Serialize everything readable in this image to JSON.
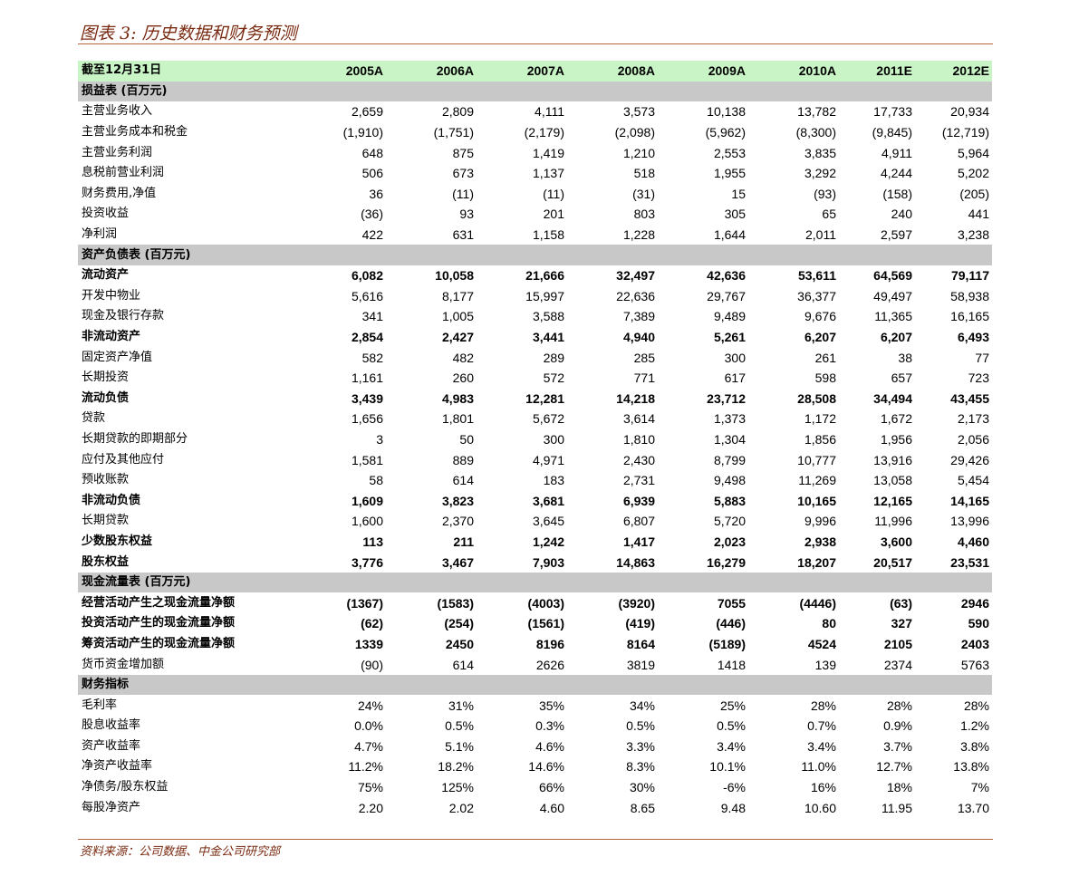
{
  "title": "图表 3: 历史数据和财务预测",
  "source": "资料来源：公司数据、中金公司研究部",
  "colors": {
    "header_bg": "#c9f5c6",
    "section_bg": "#c8c8c8",
    "title": "#7a2a10",
    "rule": "#b5643c"
  },
  "header": {
    "label": "截至12月31日",
    "years": [
      "2005A",
      "2006A",
      "2007A",
      "2008A",
      "2009A",
      "2010A",
      "2011E",
      "2012E"
    ]
  },
  "rows": [
    {
      "type": "section",
      "label": "损益表 (百万元)"
    },
    {
      "type": "row",
      "label": "主营业务收入",
      "values": [
        "2,659",
        "2,809",
        "4,111",
        "3,573",
        "10,138",
        "13,782",
        "17,733",
        "20,934"
      ]
    },
    {
      "type": "row",
      "label": "主营业务成本和税金",
      "values": [
        "(1,910)",
        "(1,751)",
        "(2,179)",
        "(2,098)",
        "(5,962)",
        "(8,300)",
        "(9,845)",
        "(12,719)"
      ]
    },
    {
      "type": "row",
      "label": "主营业务利润",
      "values": [
        "648",
        "875",
        "1,419",
        "1,210",
        "2,553",
        "3,835",
        "4,911",
        "5,964"
      ]
    },
    {
      "type": "row",
      "label": "息税前营业利润",
      "values": [
        "506",
        "673",
        "1,137",
        "518",
        "1,955",
        "3,292",
        "4,244",
        "5,202"
      ]
    },
    {
      "type": "row",
      "label": "财务费用,净值",
      "values": [
        "36",
        "(11)",
        "(11)",
        "(31)",
        "15",
        "(93)",
        "(158)",
        "(205)"
      ]
    },
    {
      "type": "row",
      "label": "投资收益",
      "values": [
        "(36)",
        "93",
        "201",
        "803",
        "305",
        "65",
        "240",
        "441"
      ]
    },
    {
      "type": "row",
      "label": "净利润",
      "values": [
        "422",
        "631",
        "1,158",
        "1,228",
        "1,644",
        "2,011",
        "2,597",
        "3,238"
      ]
    },
    {
      "type": "section",
      "label": "资产负债表 (百万元)"
    },
    {
      "type": "bold",
      "label": "流动资产",
      "values": [
        "6,082",
        "10,058",
        "21,666",
        "32,497",
        "42,636",
        "53,611",
        "64,569",
        "79,117"
      ]
    },
    {
      "type": "row",
      "label": "开发中物业",
      "values": [
        "5,616",
        "8,177",
        "15,997",
        "22,636",
        "29,767",
        "36,377",
        "49,497",
        "58,938"
      ]
    },
    {
      "type": "row",
      "label": "现金及银行存款",
      "values": [
        "341",
        "1,005",
        "3,588",
        "7,389",
        "9,489",
        "9,676",
        "11,365",
        "16,165"
      ]
    },
    {
      "type": "bold",
      "label": "非流动资产",
      "values": [
        "2,854",
        "2,427",
        "3,441",
        "4,940",
        "5,261",
        "6,207",
        "6,207",
        "6,493"
      ]
    },
    {
      "type": "row",
      "label": "固定资产净值",
      "values": [
        "582",
        "482",
        "289",
        "285",
        "300",
        "261",
        "38",
        "77"
      ]
    },
    {
      "type": "row",
      "label": "长期投资",
      "values": [
        "1,161",
        "260",
        "572",
        "771",
        "617",
        "598",
        "657",
        "723"
      ]
    },
    {
      "type": "bold",
      "label": "流动负债",
      "values": [
        "3,439",
        "4,983",
        "12,281",
        "14,218",
        "23,712",
        "28,508",
        "34,494",
        "43,455"
      ]
    },
    {
      "type": "row",
      "label": "贷款",
      "values": [
        "1,656",
        "1,801",
        "5,672",
        "3,614",
        "1,373",
        "1,172",
        "1,672",
        "2,173"
      ]
    },
    {
      "type": "row",
      "label": "长期贷款的即期部分",
      "values": [
        "3",
        "50",
        "300",
        "1,810",
        "1,304",
        "1,856",
        "1,956",
        "2,056"
      ]
    },
    {
      "type": "row",
      "label": "应付及其他应付",
      "values": [
        "1,581",
        "889",
        "4,971",
        "2,430",
        "8,799",
        "10,777",
        "13,916",
        "29,426"
      ]
    },
    {
      "type": "row",
      "label": "预收账款",
      "values": [
        "58",
        "614",
        "183",
        "2,731",
        "9,498",
        "11,269",
        "13,058",
        "5,454"
      ]
    },
    {
      "type": "bold",
      "label": "非流动负债",
      "values": [
        "1,609",
        "3,823",
        "3,681",
        "6,939",
        "5,883",
        "10,165",
        "12,165",
        "14,165"
      ]
    },
    {
      "type": "row",
      "label": "长期贷款",
      "values": [
        "1,600",
        "2,370",
        "3,645",
        "6,807",
        "5,720",
        "9,996",
        "11,996",
        "13,996"
      ]
    },
    {
      "type": "bold",
      "label": "少数股东权益",
      "values": [
        "113",
        "211",
        "1,242",
        "1,417",
        "2,023",
        "2,938",
        "3,600",
        "4,460"
      ]
    },
    {
      "type": "bold",
      "label": "股东权益",
      "values": [
        "3,776",
        "3,467",
        "7,903",
        "14,863",
        "16,279",
        "18,207",
        "20,517",
        "23,531"
      ]
    },
    {
      "type": "section",
      "label": "现金流量表 (百万元)"
    },
    {
      "type": "bold",
      "label": "经营活动产生之现金流量净额",
      "values": [
        "(1367)",
        "(1583)",
        "(4003)",
        "(3920)",
        "7055",
        "(4446)",
        "(63)",
        "2946"
      ]
    },
    {
      "type": "bold",
      "label": "投资活动产生的现金流量净额",
      "values": [
        "(62)",
        "(254)",
        "(1561)",
        "(419)",
        "(446)",
        "80",
        "327",
        "590"
      ]
    },
    {
      "type": "bold",
      "label": "筹资活动产生的现金流量净额",
      "values": [
        "1339",
        "2450",
        "8196",
        "8164",
        "(5189)",
        "4524",
        "2105",
        "2403"
      ]
    },
    {
      "type": "row",
      "label": "货币资金增加额",
      "values": [
        "(90)",
        "614",
        "2626",
        "3819",
        "1418",
        "139",
        "2374",
        "5763"
      ]
    },
    {
      "type": "section",
      "label": "财务指标"
    },
    {
      "type": "row",
      "label": "毛利率",
      "values": [
        "24%",
        "31%",
        "35%",
        "34%",
        "25%",
        "28%",
        "28%",
        "28%"
      ]
    },
    {
      "type": "row",
      "label": "股息收益率",
      "values": [
        "0.0%",
        "0.5%",
        "0.3%",
        "0.5%",
        "0.5%",
        "0.7%",
        "0.9%",
        "1.2%"
      ]
    },
    {
      "type": "row",
      "label": "资产收益率",
      "values": [
        "4.7%",
        "5.1%",
        "4.6%",
        "3.3%",
        "3.4%",
        "3.4%",
        "3.7%",
        "3.8%"
      ]
    },
    {
      "type": "row",
      "label": "净资产收益率",
      "values": [
        "11.2%",
        "18.2%",
        "14.6%",
        "8.3%",
        "10.1%",
        "11.0%",
        "12.7%",
        "13.8%"
      ]
    },
    {
      "type": "row",
      "label": "净债务/股东权益",
      "values": [
        "75%",
        "125%",
        "66%",
        "30%",
        "-6%",
        "16%",
        "18%",
        "7%"
      ]
    },
    {
      "type": "row",
      "label": "每股净资产",
      "values": [
        "2.20",
        "2.02",
        "4.60",
        "8.65",
        "9.48",
        "10.60",
        "11.95",
        "13.70"
      ]
    }
  ]
}
